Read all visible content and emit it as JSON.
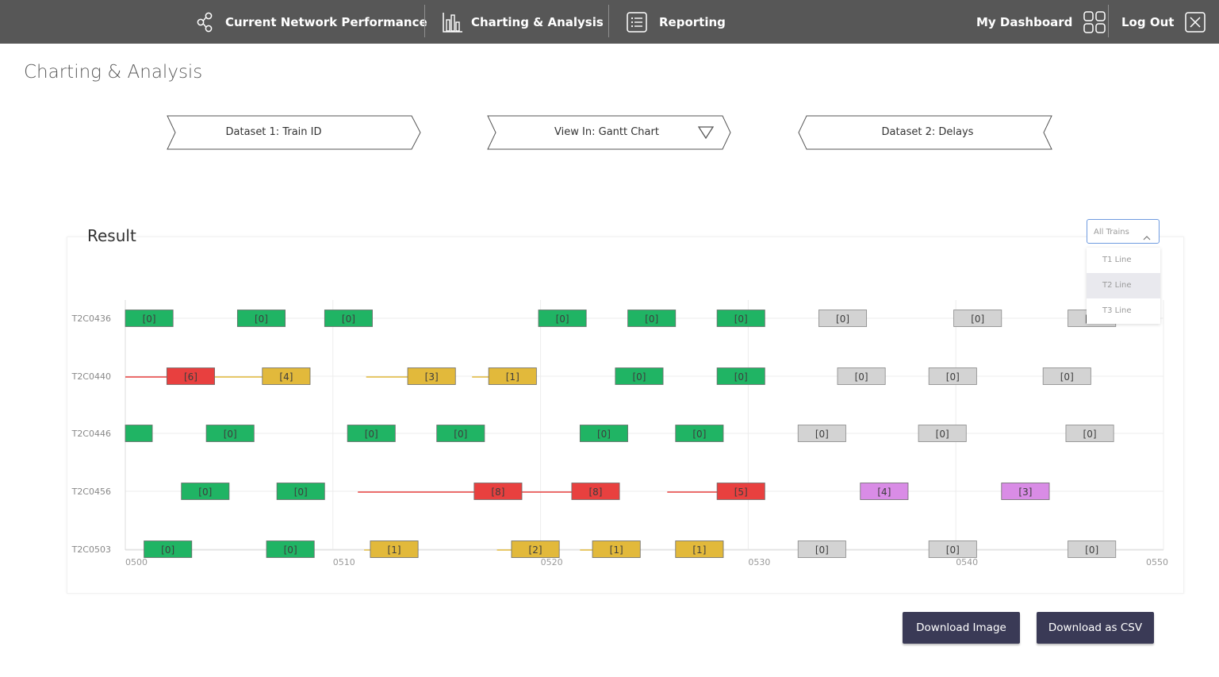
{
  "nav": {
    "network_label": "Current Network Performance",
    "charting_label": "Charting & Analysis",
    "reporting_label": "Reporting",
    "dashboard_label": "My Dashboard",
    "logout_label": "Log Out"
  },
  "page_title": "Charting & Analysis",
  "selectors": {
    "dataset1": "Dataset 1: Train ID",
    "view": "View In: Gantt Chart",
    "dataset2": "Dataset 2: Delays"
  },
  "result_title": "Result",
  "train_filter": {
    "selected": "All Trains",
    "options": [
      "T1 Line",
      "T2 Line",
      "T3 Line"
    ],
    "highlighted": "T2 Line"
  },
  "buttons": {
    "download_image": "Download Image",
    "download_csv": "Download as CSV"
  },
  "colors": {
    "nav_bg": "#575757",
    "on_time": "#20b464",
    "minor_delay": "#e2b93b",
    "major_delay": "#e8403f",
    "other": "#d98ce6",
    "scheduled": "#d3d3d3",
    "button_bg": "#3a3a56"
  },
  "chart_data": {
    "type": "gantt",
    "x_ticks": [
      "0500",
      "0510",
      "0520",
      "0530",
      "0540",
      "0550"
    ],
    "x_range": [
      0,
      50
    ],
    "rows": [
      {
        "train": "T2C0436",
        "bars": [
          {
            "start": 0.0,
            "end": 2.3,
            "label": "[0]",
            "status": "on_time"
          },
          {
            "start": 5.4,
            "end": 7.7,
            "label": "[0]",
            "status": "on_time"
          },
          {
            "start": 9.6,
            "end": 11.9,
            "label": "[0]",
            "status": "on_time"
          },
          {
            "start": 19.9,
            "end": 22.2,
            "label": "[0]",
            "status": "on_time"
          },
          {
            "start": 24.2,
            "end": 26.5,
            "label": "[0]",
            "status": "on_time"
          },
          {
            "start": 28.5,
            "end": 30.8,
            "label": "[0]",
            "status": "on_time"
          },
          {
            "start": 33.4,
            "end": 35.7,
            "label": "[0]",
            "status": "scheduled"
          },
          {
            "start": 39.9,
            "end": 42.2,
            "label": "[0]",
            "status": "scheduled"
          },
          {
            "start": 45.4,
            "end": 47.7,
            "label": "[0]",
            "status": "scheduled"
          }
        ],
        "links": []
      },
      {
        "train": "T2C0440",
        "bars": [
          {
            "start": 2.0,
            "end": 4.3,
            "label": "[6]",
            "status": "major_delay"
          },
          {
            "start": 6.6,
            "end": 8.9,
            "label": "[4]",
            "status": "minor_delay"
          },
          {
            "start": 13.6,
            "end": 15.9,
            "label": "[3]",
            "status": "minor_delay"
          },
          {
            "start": 17.5,
            "end": 19.8,
            "label": "[1]",
            "status": "minor_delay"
          },
          {
            "start": 23.6,
            "end": 25.9,
            "label": "[0]",
            "status": "on_time"
          },
          {
            "start": 28.5,
            "end": 30.8,
            "label": "[0]",
            "status": "on_time"
          },
          {
            "start": 34.3,
            "end": 36.6,
            "label": "[0]",
            "status": "scheduled"
          },
          {
            "start": 38.7,
            "end": 41.0,
            "label": "[0]",
            "status": "scheduled"
          },
          {
            "start": 44.2,
            "end": 46.5,
            "label": "[0]",
            "status": "scheduled"
          }
        ],
        "links": [
          {
            "start": 0.0,
            "end": 2.0,
            "status": "major_delay"
          },
          {
            "start": 4.3,
            "end": 6.6,
            "status": "minor_delay"
          },
          {
            "start": 11.6,
            "end": 13.6,
            "status": "minor_delay"
          },
          {
            "start": 16.7,
            "end": 17.5,
            "status": "minor_delay"
          }
        ]
      },
      {
        "train": "T2C0446",
        "bars": [
          {
            "start": 0.0,
            "end": 1.3,
            "label": "",
            "status": "on_time"
          },
          {
            "start": 3.9,
            "end": 6.2,
            "label": "[0]",
            "status": "on_time"
          },
          {
            "start": 10.7,
            "end": 13.0,
            "label": "[0]",
            "status": "on_time"
          },
          {
            "start": 15.0,
            "end": 17.3,
            "label": "[0]",
            "status": "on_time"
          },
          {
            "start": 21.9,
            "end": 24.2,
            "label": "[0]",
            "status": "on_time"
          },
          {
            "start": 26.5,
            "end": 28.8,
            "label": "[0]",
            "status": "on_time"
          },
          {
            "start": 32.4,
            "end": 34.7,
            "label": "[0]",
            "status": "scheduled"
          },
          {
            "start": 38.2,
            "end": 40.5,
            "label": "[0]",
            "status": "scheduled"
          },
          {
            "start": 45.3,
            "end": 47.6,
            "label": "[0]",
            "status": "scheduled"
          }
        ],
        "links": []
      },
      {
        "train": "T2C0456",
        "bars": [
          {
            "start": 2.7,
            "end": 5.0,
            "label": "[0]",
            "status": "on_time"
          },
          {
            "start": 7.3,
            "end": 9.6,
            "label": "[0]",
            "status": "on_time"
          },
          {
            "start": 16.8,
            "end": 19.1,
            "label": "[8]",
            "status": "major_delay"
          },
          {
            "start": 21.5,
            "end": 23.8,
            "label": "[8]",
            "status": "major_delay"
          },
          {
            "start": 28.5,
            "end": 30.8,
            "label": "[5]",
            "status": "major_delay"
          },
          {
            "start": 35.4,
            "end": 37.7,
            "label": "[4]",
            "status": "other"
          },
          {
            "start": 42.2,
            "end": 44.5,
            "label": "[3]",
            "status": "other"
          }
        ],
        "links": [
          {
            "start": 11.2,
            "end": 16.8,
            "status": "major_delay"
          },
          {
            "start": 19.1,
            "end": 21.5,
            "status": "major_delay"
          },
          {
            "start": 26.1,
            "end": 28.5,
            "status": "major_delay"
          }
        ]
      },
      {
        "train": "T2C0503",
        "bars": [
          {
            "start": 0.9,
            "end": 3.2,
            "label": "[0]",
            "status": "on_time"
          },
          {
            "start": 6.8,
            "end": 9.1,
            "label": "[0]",
            "status": "on_time"
          },
          {
            "start": 11.8,
            "end": 14.1,
            "label": "[1]",
            "status": "minor_delay"
          },
          {
            "start": 18.6,
            "end": 20.9,
            "label": "[2]",
            "status": "minor_delay"
          },
          {
            "start": 22.5,
            "end": 24.8,
            "label": "[1]",
            "status": "minor_delay"
          },
          {
            "start": 26.5,
            "end": 28.8,
            "label": "[1]",
            "status": "minor_delay"
          },
          {
            "start": 32.4,
            "end": 34.7,
            "label": "[0]",
            "status": "scheduled"
          },
          {
            "start": 38.7,
            "end": 41.0,
            "label": "[0]",
            "status": "scheduled"
          },
          {
            "start": 45.4,
            "end": 47.7,
            "label": "[0]",
            "status": "scheduled"
          }
        ],
        "links": [
          {
            "start": 11.5,
            "end": 11.8,
            "status": "minor_delay"
          },
          {
            "start": 17.9,
            "end": 18.6,
            "status": "minor_delay"
          },
          {
            "start": 21.9,
            "end": 22.5,
            "status": "minor_delay"
          }
        ]
      }
    ]
  }
}
